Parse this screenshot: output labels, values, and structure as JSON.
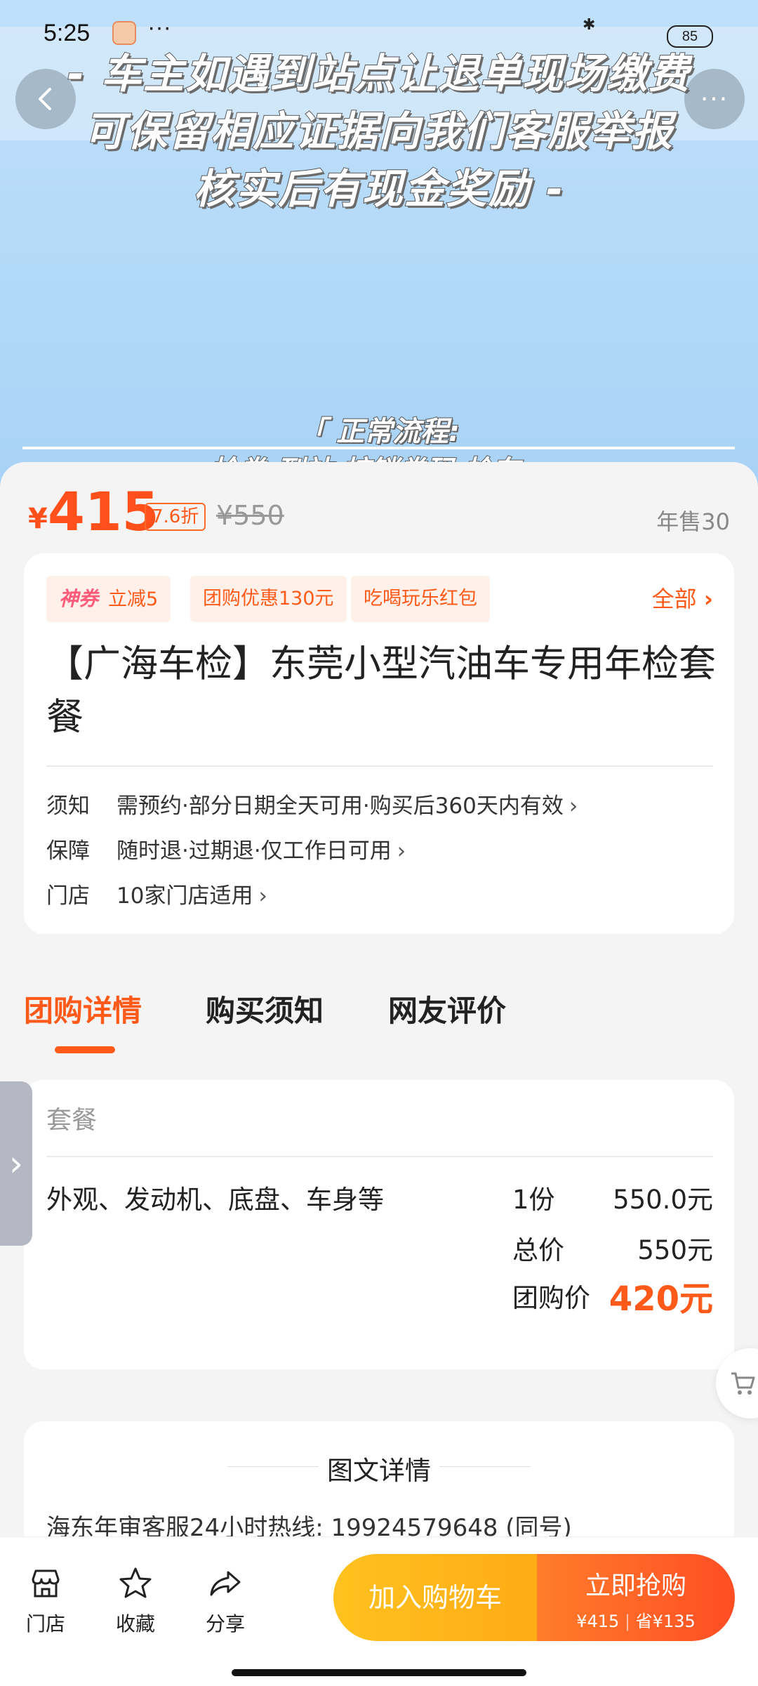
{
  "status_bar": {
    "time": "5:25",
    "more": "···",
    "battery": "85"
  },
  "hero": {
    "overlay_line1": "- 车主如遇到站点让退单现场缴费",
    "overlay_line2": "可保留相应证据向我们客服举报",
    "overlay_line3": "核实后有现金奖励 -",
    "flow_label": "「 正常流程:",
    "flow_cut": "抢券 到站 核销券码 检车」",
    "more_label": "···"
  },
  "price": {
    "currency": "¥",
    "current": "415",
    "discount": "7.6折",
    "original": "¥550",
    "annual_sales": "年售30"
  },
  "tags": {
    "special_label": "神券",
    "special_text": "立减5",
    "group_discount": "团购优惠130元",
    "red_packet": "吃喝玩乐红包",
    "all_label": "全部"
  },
  "title": "【广海车检】东莞小型汽油车专用年检套餐",
  "info": [
    {
      "key": "须知",
      "value": "需预约·部分日期全天可用·购买后360天内有效"
    },
    {
      "key": "保障",
      "value": "随时退·过期退·仅工作日可用"
    },
    {
      "key": "门店",
      "value": "10家门店适用"
    }
  ],
  "tabs": [
    "团购详情",
    "购买须知",
    "网友评价"
  ],
  "package": {
    "header": "套餐",
    "item": "外观、发动机、底盘、车身等",
    "qty": "1份",
    "price": "550.0元",
    "total_label": "总价",
    "total_value": "550元",
    "group_label": "团购价",
    "group_value": "420元"
  },
  "details": {
    "title": "图文详情",
    "cut_text": "海东年审客服24小时热线: 19924579648 (同号)"
  },
  "bottom_bar": {
    "store": "门店",
    "favorite": "收藏",
    "share": "分享",
    "add_cart": "加入购物车",
    "buy_now": "立即抢购",
    "buy_price": "¥415",
    "buy_save": "省¥135"
  },
  "colors": {
    "accent": "#ff5a1a",
    "cart_yellow": "#ffb81a",
    "hero_blue": "#b3d9f8"
  }
}
